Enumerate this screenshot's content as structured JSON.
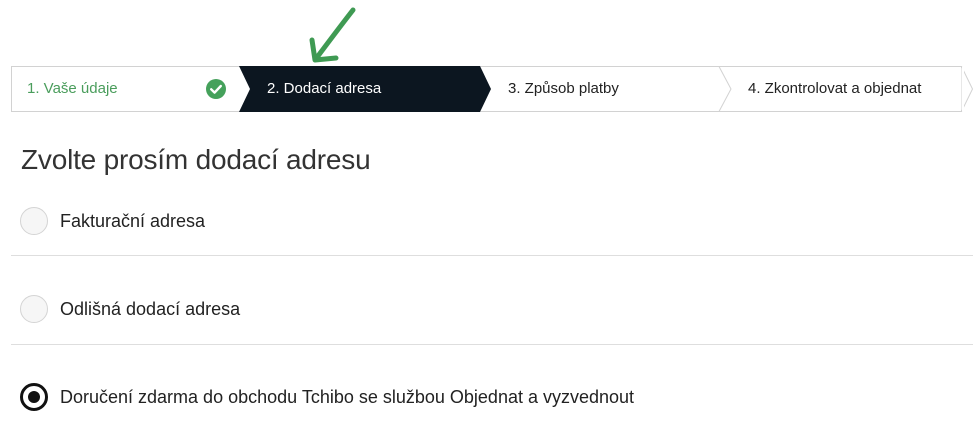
{
  "stepper": {
    "steps": [
      {
        "label": "1. Vaše údaje",
        "state": "completed"
      },
      {
        "label": "2. Dodací adresa",
        "state": "active"
      },
      {
        "label": "3. Způsob platby",
        "state": "upcoming"
      },
      {
        "label": "4. Zkontrolovat a objednat",
        "state": "upcoming"
      }
    ],
    "colors": {
      "active_bg": "#0c1620",
      "completed_text": "#4a9d5c",
      "check": "#45a15b",
      "border": "#d2d2d2"
    }
  },
  "annotation": {
    "icon": "green-arrow-icon",
    "color": "#3f9a53"
  },
  "main": {
    "title": "Zvolte prosím dodací adresu",
    "options": [
      {
        "label": "Fakturační adresa",
        "selected": false
      },
      {
        "label": "Odlišná dodací adresa",
        "selected": false
      },
      {
        "label": "Doručení zdarma do obchodu Tchibo se službou Objednat a vyzvednout",
        "selected": true
      }
    ]
  }
}
